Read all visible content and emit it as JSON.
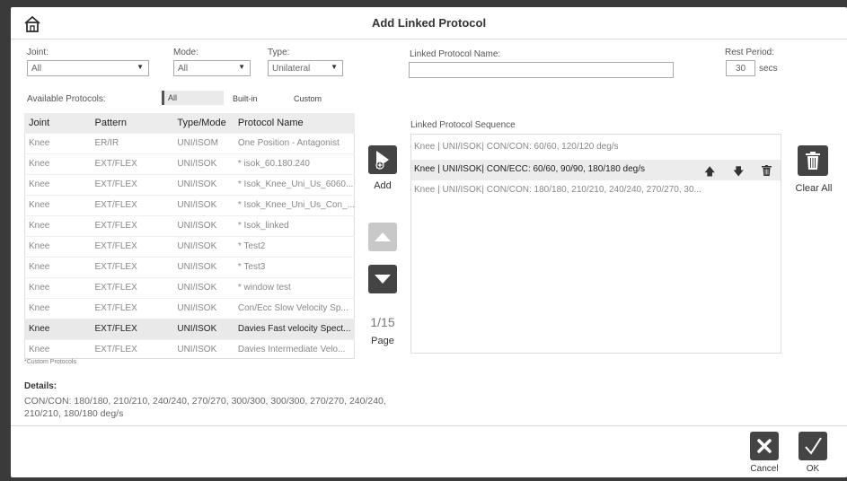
{
  "window": {
    "title": "Add Linked Protocol"
  },
  "filters": {
    "joint_label": "Joint:",
    "joint_value": "All",
    "mode_label": "Mode:",
    "mode_value": "All",
    "type_label": "Type:",
    "type_value": "Unilateral"
  },
  "linked": {
    "name_label": "Linked Protocol Name:",
    "name_value": "",
    "rest_label": "Rest Period:",
    "rest_value": "30",
    "rest_unit": "secs"
  },
  "available": {
    "label": "Available Protocols:",
    "filter_tabs": [
      "All",
      "Built-in",
      "Custom"
    ],
    "active_tab": "All",
    "columns": [
      "Joint",
      "Pattern",
      "Type/Mode",
      "Protocol Name"
    ],
    "rows": [
      [
        "Knee",
        "ER/IR",
        "UNI/ISOM",
        "One Position - Antagonist"
      ],
      [
        "Knee",
        "EXT/FLEX",
        "UNI/ISOK",
        "* isok_60.180.240"
      ],
      [
        "Knee",
        "EXT/FLEX",
        "UNI/ISOK",
        "* Isok_Knee_Uni_Us_6060..."
      ],
      [
        "Knee",
        "EXT/FLEX",
        "UNI/ISOK",
        "* Isok_Knee_Uni_Us_Con_..."
      ],
      [
        "Knee",
        "EXT/FLEX",
        "UNI/ISOK",
        "* Isok_linked"
      ],
      [
        "Knee",
        "EXT/FLEX",
        "UNI/ISOK",
        "* Test2"
      ],
      [
        "Knee",
        "EXT/FLEX",
        "UNI/ISOK",
        "* Test3"
      ],
      [
        "Knee",
        "EXT/FLEX",
        "UNI/ISOK",
        "* window test"
      ],
      [
        "Knee",
        "EXT/FLEX",
        "UNI/ISOK",
        "Con/Ecc Slow Velocity Sp..."
      ],
      [
        "Knee",
        "EXT/FLEX",
        "UNI/ISOK",
        "Davies Fast velocity Spect..."
      ],
      [
        "Knee",
        "EXT/FLEX",
        "UNI/ISOK",
        "Davies Intermediate Velo..."
      ]
    ],
    "selected_row": 9,
    "footnote": "*Custom Protocols"
  },
  "controls": {
    "add_label": "Add",
    "page_count": "1/15",
    "page_label": "Page"
  },
  "sequence": {
    "label": "Linked Protocol Sequence",
    "items": [
      "Knee | UNI/ISOK| CON/CON: 60/60, 120/120 deg/s",
      "Knee | UNI/ISOK| CON/ECC: 60/60, 90/90, 180/180 deg/s",
      "Knee | UNI/ISOK| CON/CON: 180/180, 210/210, 240/240, 270/270, 30..."
    ],
    "selected_item": 1,
    "clear_all_label": "Clear All"
  },
  "details": {
    "label": "Details:",
    "line1": "CON/CON: 180/180, 210/210, 240/240, 270/270, 300/300, 300/300, 270/270, 240/240,",
    "line2": "210/210, 180/180 deg/s"
  },
  "footer": {
    "cancel_label": "Cancel",
    "ok_label": "OK"
  },
  "icons": [
    "home-icon",
    "add-icon",
    "arrow-up-icon",
    "arrow-down-icon",
    "trash-icon",
    "close-icon",
    "check-icon"
  ]
}
